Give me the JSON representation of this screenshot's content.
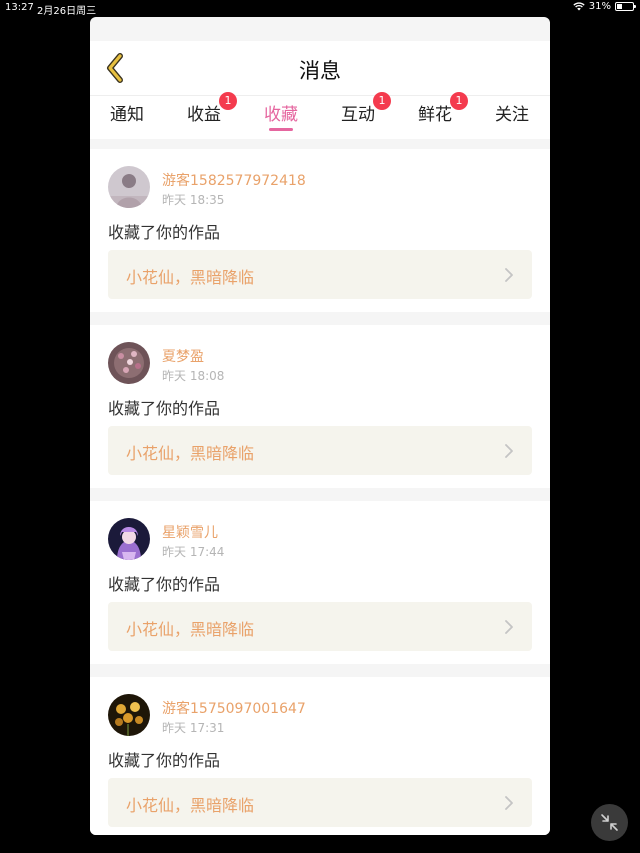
{
  "statusbar": {
    "time": "13:27",
    "date": "2月26日周三",
    "battery": "31%",
    "battery_level": 0.31
  },
  "header": {
    "title": "消息",
    "back_icon": "chevron-left-icon"
  },
  "tabs": [
    {
      "label": "通知",
      "badge": ""
    },
    {
      "label": "收益",
      "badge": "1"
    },
    {
      "label": "收藏",
      "badge": "",
      "active": true
    },
    {
      "label": "互动",
      "badge": "1"
    },
    {
      "label": "鲜花",
      "badge": "1"
    },
    {
      "label": "关注",
      "badge": ""
    }
  ],
  "messages": [
    {
      "username": "游客1582577972418",
      "time": "昨天 18:35",
      "action": "收藏了你的作品",
      "work": "小花仙，黑暗降临"
    },
    {
      "username": "夏梦盈",
      "time": "昨天 18:08",
      "action": "收藏了你的作品",
      "work": "小花仙，黑暗降临"
    },
    {
      "username": "星颖雪儿",
      "time": "昨天 17:44",
      "action": "收藏了你的作品",
      "work": "小花仙，黑暗降临"
    },
    {
      "username": "游客1575097001647",
      "time": "昨天 17:31",
      "action": "收藏了你的作品",
      "work": "小花仙，黑暗降临"
    }
  ],
  "colors": {
    "accent": "#e5669f",
    "username": "#e9a26a",
    "badge": "#f43b4e",
    "back_icon": "#d9a826"
  }
}
